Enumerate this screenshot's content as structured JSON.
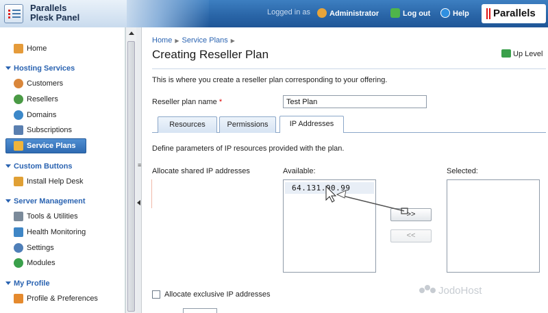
{
  "header": {
    "app_name_line1": "Parallels",
    "app_name_line2": "Plesk Panel",
    "logged_in_label": "Logged in as",
    "user_name": "Administrator",
    "logout_label": "Log out",
    "help_label": "Help",
    "brand": "Parallels"
  },
  "sidebar": {
    "home": "Home",
    "sections": [
      {
        "title": "Hosting Services",
        "items": [
          "Customers",
          "Resellers",
          "Domains",
          "Subscriptions",
          "Service Plans"
        ]
      },
      {
        "title": "Custom Buttons",
        "items": [
          "Install Help Desk"
        ]
      },
      {
        "title": "Server Management",
        "items": [
          "Tools & Utilities",
          "Health Monitoring",
          "Settings",
          "Modules"
        ]
      },
      {
        "title": "My Profile",
        "items": [
          "Profile & Preferences"
        ]
      }
    ],
    "active_item": "Service Plans"
  },
  "breadcrumb": [
    "Home",
    "Service Plans"
  ],
  "page": {
    "title": "Creating Reseller Plan",
    "up_level": "Up Level",
    "intro": "This is where you create a reseller plan corresponding to your offering.",
    "plan_name_label": "Reseller plan name",
    "required_mark": "*",
    "plan_name_value": "Test Plan"
  },
  "tabs": [
    {
      "label": "Resources",
      "active": false
    },
    {
      "label": "Permissions",
      "active": false
    },
    {
      "label": "IP Addresses",
      "active": true
    }
  ],
  "ip_section": {
    "description": "Define parameters of IP resources provided with the plan.",
    "shared_label": "Allocate shared IP addresses",
    "available_label": "Available:",
    "selected_label": "Selected:",
    "available_items": [
      "64.131.90.99"
    ],
    "selected_items": [],
    "add_button": ">>",
    "remove_button": "<<",
    "exclusive_label": "Allocate exclusive IP addresses"
  },
  "watermark": "JodoHost",
  "colors": {
    "header_blue": "#2a66a8",
    "link_blue": "#2a63b1",
    "active_nav": "#3a78c0"
  }
}
